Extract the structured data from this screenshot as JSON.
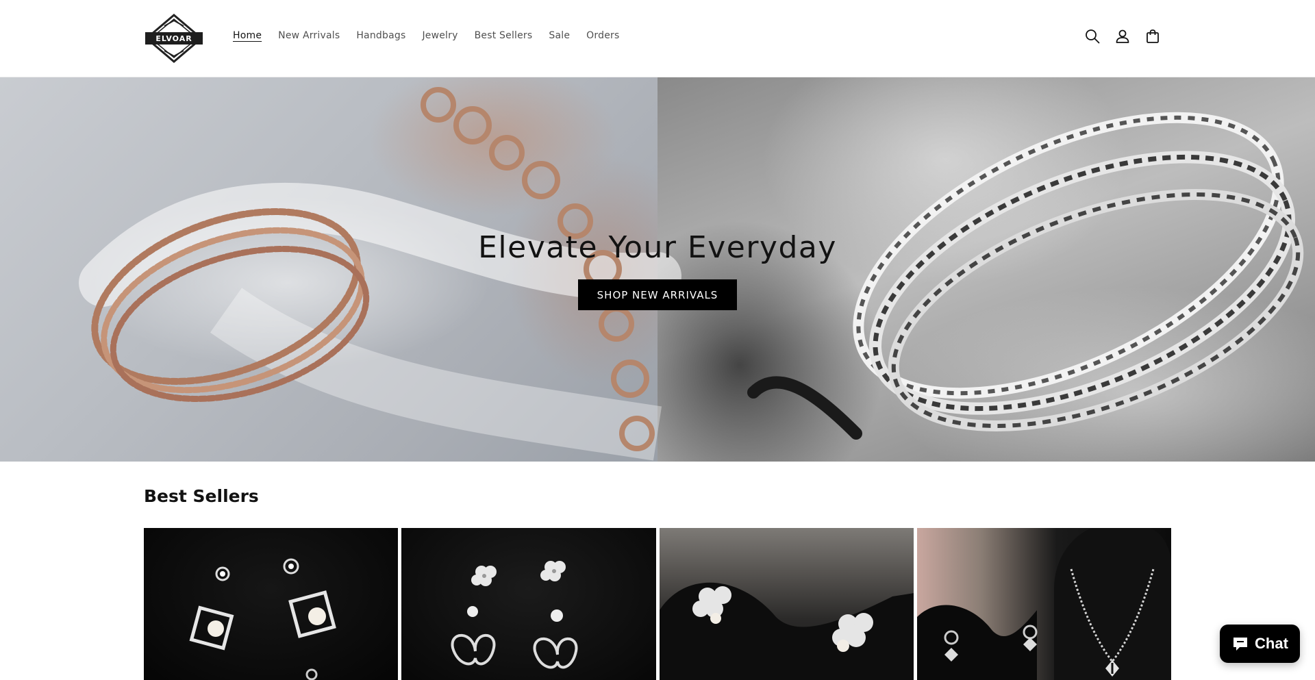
{
  "brand": {
    "logo_text": "ELVOAR"
  },
  "nav": {
    "items": [
      {
        "label": "Home",
        "active": true
      },
      {
        "label": "New Arrivals"
      },
      {
        "label": "Handbags"
      },
      {
        "label": "Jewelry"
      },
      {
        "label": "Best Sellers"
      },
      {
        "label": "Sale"
      },
      {
        "label": "Orders"
      }
    ]
  },
  "header_icons": [
    "search-icon",
    "account-icon",
    "cart-icon"
  ],
  "hero": {
    "title": "Elevate Your Everyday",
    "button_label": "SHOP NEW ARRIVALS"
  },
  "best_sellers": {
    "title": "Best Sellers",
    "products": [
      {
        "image": "silver stud earrings set with pearls"
      },
      {
        "image": "butterfly and flower stud earrings"
      },
      {
        "image": "clover stud earrings on display stand"
      },
      {
        "image": "clover drop earrings and necklace set"
      }
    ]
  },
  "chat": {
    "label": "Chat"
  },
  "colors": {
    "text": "#121212",
    "button": "#000000",
    "background": "#ffffff"
  }
}
